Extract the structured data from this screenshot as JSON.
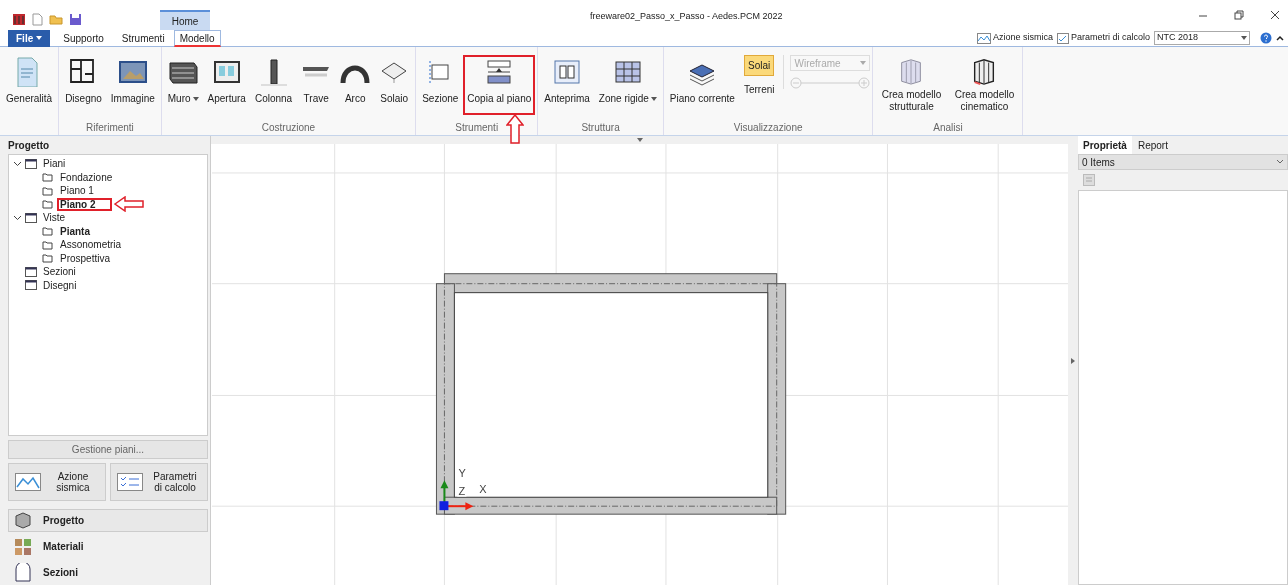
{
  "window": {
    "title": "freeware02_Passo_x_Passo - Aedes.PCM 2022"
  },
  "ribbon_tabs": {
    "file": "File",
    "contextual": "Home",
    "tabs": [
      {
        "label": "Supporto",
        "selected": false
      },
      {
        "label": "Strumenti",
        "selected": false
      },
      {
        "label": "Modello",
        "selected": true
      }
    ]
  },
  "top_right": {
    "azione_sismica": "Azione sismica",
    "parametri": "Parametri di calcolo",
    "norm": "NTC 2018"
  },
  "ribbon_groups": [
    {
      "items": [
        {
          "label": "Generalità",
          "kind": "button",
          "highlighted": false
        }
      ]
    },
    {
      "name": "Riferimenti",
      "items": [
        {
          "label": "Disegno",
          "kind": "button",
          "highlighted": false
        },
        {
          "label": "Immagine",
          "kind": "button",
          "highlighted": false
        }
      ]
    },
    {
      "name": "Costruzione",
      "items": [
        {
          "label": "Muro",
          "kind": "dropdown",
          "highlighted": false
        },
        {
          "label": "Apertura",
          "kind": "button",
          "highlighted": false
        },
        {
          "label": "Colonna",
          "kind": "button",
          "highlighted": false
        },
        {
          "label": "Trave",
          "kind": "button",
          "highlighted": false
        },
        {
          "label": "Arco",
          "kind": "button",
          "highlighted": false
        },
        {
          "label": "Solaio",
          "kind": "button",
          "highlighted": false
        }
      ]
    },
    {
      "name": "Strumenti",
      "items": [
        {
          "label": "Sezione",
          "kind": "button",
          "highlighted": false
        },
        {
          "label": "Copia al piano",
          "kind": "button",
          "highlighted": true
        }
      ]
    },
    {
      "name": "Struttura",
      "items": [
        {
          "label": "Anteprima",
          "kind": "button",
          "highlighted": false
        },
        {
          "label": "Zone rigide",
          "kind": "dropdown",
          "highlighted": false
        }
      ]
    },
    {
      "name": "Visualizzazione",
      "items": [
        {
          "label": "Piano corrente",
          "kind": "button",
          "highlighted": false
        },
        {
          "label": "Solai",
          "kind": "toggle",
          "on": true,
          "sub": "Terreni"
        },
        {
          "label": "Wireframe",
          "kind": "combo",
          "disabled": true
        }
      ]
    },
    {
      "name": "Analisi",
      "items": [
        {
          "label": "Crea modello strutturale",
          "kind": "button",
          "highlighted": false
        },
        {
          "label": "Crea modello cinematico",
          "kind": "button",
          "highlighted": false
        }
      ]
    }
  ],
  "project_panel": {
    "title": "Progetto",
    "tree": [
      {
        "label": "Piani",
        "expanded": true,
        "current": false,
        "highlighted": false,
        "children": [
          {
            "label": "Fondazione",
            "current": false,
            "highlighted": false
          },
          {
            "label": "Piano 1",
            "current": false,
            "highlighted": false
          },
          {
            "label": "Piano 2",
            "current": true,
            "highlighted": true
          }
        ]
      },
      {
        "label": "Viste",
        "expanded": true,
        "current": false,
        "highlighted": false,
        "children": [
          {
            "label": "Pianta",
            "current": true,
            "highlighted": false
          },
          {
            "label": "Assonometria",
            "current": false,
            "highlighted": false
          },
          {
            "label": "Prospettiva",
            "current": false,
            "highlighted": false
          }
        ]
      },
      {
        "label": "Sezioni",
        "current": false,
        "highlighted": false
      },
      {
        "label": "Disegni",
        "current": false,
        "highlighted": false
      }
    ],
    "manage_button": "Gestione piani...",
    "buttons": [
      "Azione sismica",
      "Parametri di calcolo"
    ],
    "nav": [
      {
        "label": "Progetto",
        "selected": true
      },
      {
        "label": "Materiali",
        "selected": false
      },
      {
        "label": "Sezioni",
        "selected": false
      }
    ]
  },
  "canvas": {
    "axes": {
      "x": "X",
      "y": "Y",
      "z": "Z"
    }
  },
  "properties_panel": {
    "tabs": [
      {
        "label": "Proprietà",
        "selected": true
      },
      {
        "label": "Report",
        "selected": false
      }
    ],
    "selector": "0 Items"
  }
}
